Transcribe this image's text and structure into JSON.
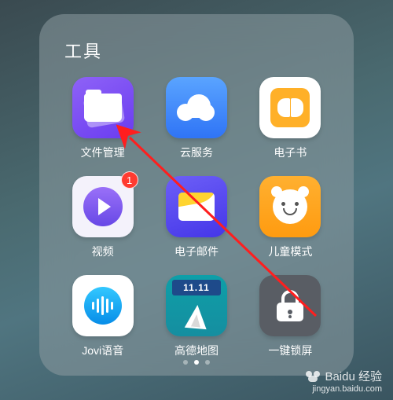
{
  "folder_title": "工具",
  "apps": [
    {
      "key": "files",
      "label": "文件管理",
      "badge": null
    },
    {
      "key": "cloud",
      "label": "云服务",
      "badge": null
    },
    {
      "key": "book",
      "label": "电子书",
      "badge": null
    },
    {
      "key": "video",
      "label": "视频",
      "badge": "1"
    },
    {
      "key": "mail",
      "label": "电子邮件",
      "badge": null
    },
    {
      "key": "child",
      "label": "儿童模式",
      "badge": null
    },
    {
      "key": "jovi",
      "label": "Jovi语音",
      "badge": null
    },
    {
      "key": "map",
      "label": "高德地图",
      "badge": null,
      "banner": "11.11"
    },
    {
      "key": "lock",
      "label": "一键锁屏",
      "badge": null
    }
  ],
  "page_indicator": {
    "total": 3,
    "active": 1
  },
  "watermark": {
    "brand": "Baidu",
    "suffix": "经验",
    "url": "jingyan.baidu.com"
  }
}
